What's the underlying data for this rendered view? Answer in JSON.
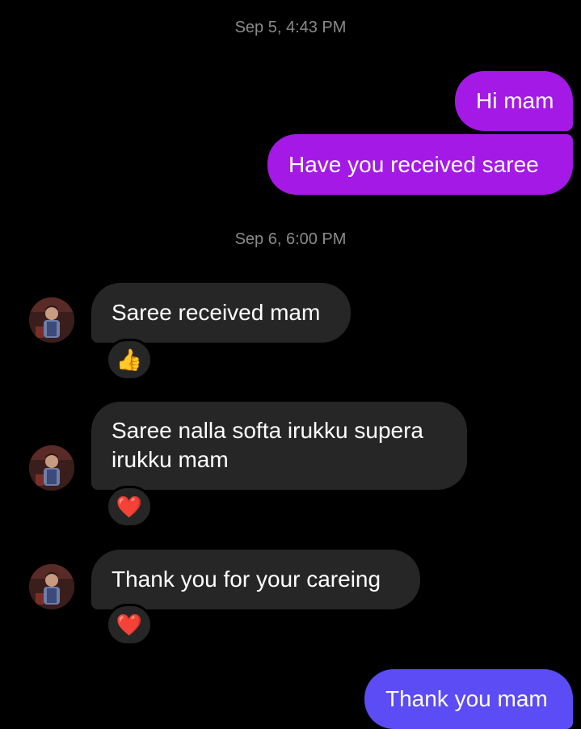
{
  "timestamps": [
    "Sep 5, 4:43 PM",
    "Sep 6, 6:00 PM"
  ],
  "colors": {
    "background": "#000000",
    "outgoing_bubble_top": "#a419e6",
    "outgoing_bubble_bottom": "#5b4cf5",
    "incoming_bubble": "#262626",
    "timestamp_text": "#8a8a8a"
  },
  "messages": {
    "out_1": "Hi mam",
    "out_2": "Have you received saree",
    "in_1": "Saree received mam",
    "in_2_line_1": "Saree nalla softa irukku supera",
    "in_2_line_2": "irukku mam",
    "in_3": "Thank you for your careing",
    "out_3": "Thank you mam"
  },
  "reactions": {
    "in_1": "👍",
    "in_2": "❤️",
    "in_3": "❤️"
  },
  "icons": {
    "contact_avatar": "contact-avatar-photo",
    "thumbs_up": "thumbs-up-icon",
    "heart": "heart-icon"
  }
}
